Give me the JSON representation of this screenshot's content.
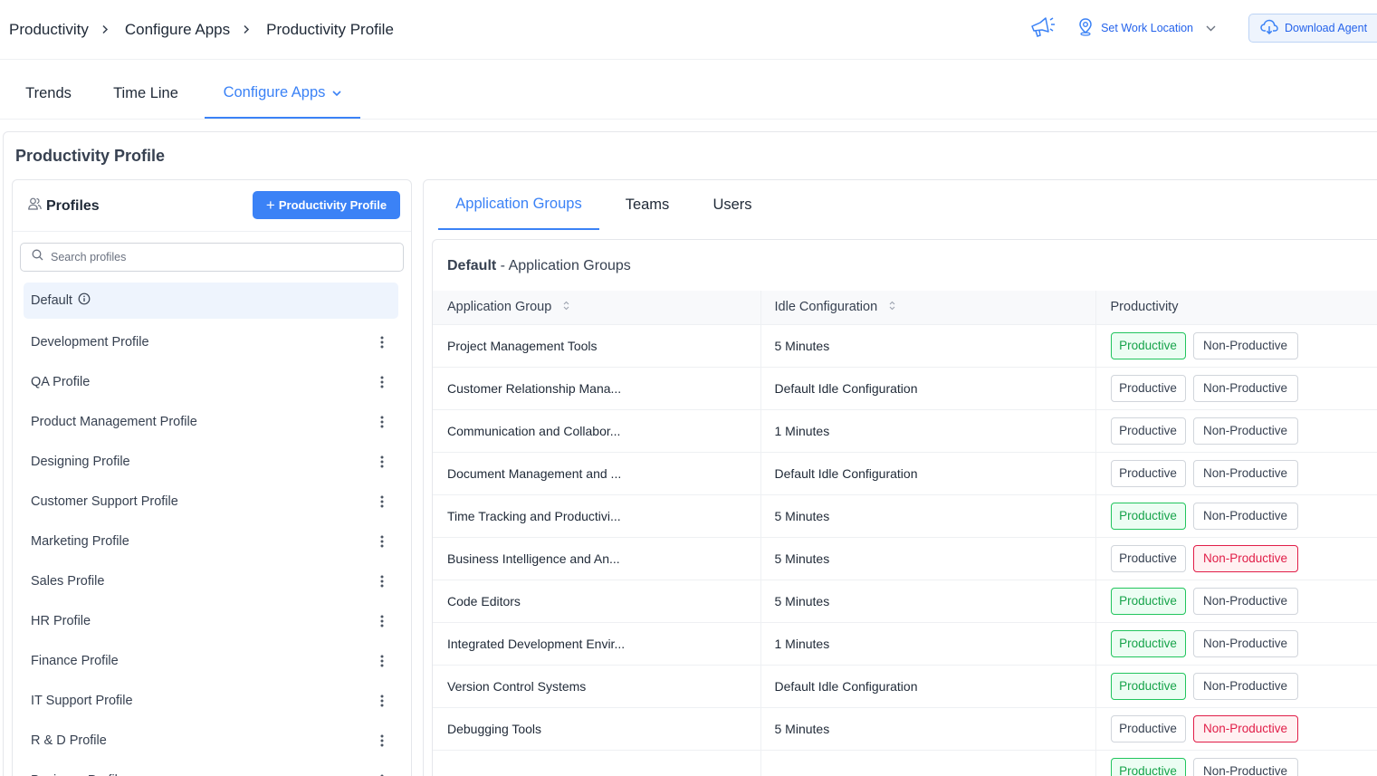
{
  "breadcrumb": [
    "Productivity",
    "Configure Apps",
    "Productivity Profile"
  ],
  "header": {
    "location_label": "Set Work Location",
    "download_label": "Download Agent",
    "accent": "#3b82f6"
  },
  "main_tabs": [
    {
      "label": "Trends"
    },
    {
      "label": "Time Line"
    },
    {
      "label": "Configure Apps"
    }
  ],
  "page_title": "Productivity Profile",
  "profiles": {
    "title": "Profiles",
    "add_label": "Productivity Profile",
    "search_placeholder": "Search profiles",
    "items": [
      "Default",
      "Development Profile",
      "QA Profile",
      "Product Management Profile",
      "Designing Profile",
      "Customer Support Profile",
      "Marketing Profile",
      "Sales Profile",
      "HR Profile",
      "Finance Profile",
      "IT Support Profile",
      "R & D Profile",
      "Business Profile"
    ]
  },
  "sub_tabs": [
    {
      "label": "Application Groups"
    },
    {
      "label": "Teams"
    },
    {
      "label": "Users"
    }
  ],
  "groups": {
    "title_bold": "Default",
    "title_rest": " - Application Groups",
    "columns": [
      "Application Group",
      "Idle Configuration",
      "Productivity"
    ],
    "productive_label": "Productive",
    "nonproductive_label": "Non-Productive",
    "rows": [
      {
        "name": "Project Management Tools",
        "idle": "5 Minutes",
        "state": "productive"
      },
      {
        "name": "Customer Relationship Mana...",
        "idle": "Default Idle Configuration",
        "state": "none"
      },
      {
        "name": "Communication and Collabor...",
        "idle": "1 Minutes",
        "state": "none"
      },
      {
        "name": "Document Management and ...",
        "idle": "Default Idle Configuration",
        "state": "none"
      },
      {
        "name": "Time Tracking and Productivi...",
        "idle": "5 Minutes",
        "state": "productive"
      },
      {
        "name": "Business Intelligence and An...",
        "idle": "5 Minutes",
        "state": "nonproductive"
      },
      {
        "name": "Code Editors",
        "idle": "5 Minutes",
        "state": "productive"
      },
      {
        "name": "Integrated Development Envir...",
        "idle": "1 Minutes",
        "state": "productive"
      },
      {
        "name": "Version Control Systems",
        "idle": "Default Idle Configuration",
        "state": "productive"
      },
      {
        "name": "Debugging Tools",
        "idle": "5 Minutes",
        "state": "nonproductive"
      },
      {
        "name": "",
        "idle": "",
        "state": "productive"
      }
    ]
  }
}
